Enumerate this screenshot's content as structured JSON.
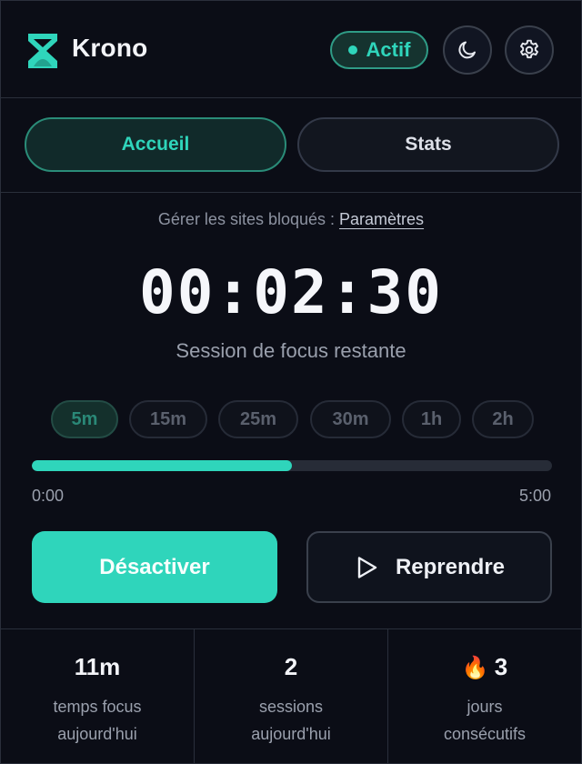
{
  "header": {
    "app_name": "Krono",
    "status_label": "Actif",
    "logo_icon": "hourglass-logo",
    "theme_icon": "moon-icon",
    "settings_icon": "gear-icon"
  },
  "tabs": [
    {
      "label": "Accueil",
      "active": true
    },
    {
      "label": "Stats",
      "active": false
    }
  ],
  "blocked_sites": {
    "prefix": "Gérer les sites bloqués : ",
    "link_label": "Paramètres"
  },
  "timer": {
    "display": "00:02:30",
    "caption": "Session de focus restante"
  },
  "durations": [
    {
      "label": "5m",
      "active": true
    },
    {
      "label": "15m",
      "active": false
    },
    {
      "label": "25m",
      "active": false
    },
    {
      "label": "30m",
      "active": false
    },
    {
      "label": "1h",
      "active": false
    },
    {
      "label": "2h",
      "active": false
    }
  ],
  "progress": {
    "fraction": 0.5,
    "start_label": "0:00",
    "end_label": "5:00"
  },
  "actions": {
    "deactivate_label": "Désactiver",
    "resume_label": "Reprendre",
    "resume_icon": "play-icon"
  },
  "stats": [
    {
      "value": "11m",
      "label_line1": "temps focus",
      "label_line2": "aujourd'hui"
    },
    {
      "value": "2",
      "label_line1": "sessions",
      "label_line2": "aujourd'hui"
    },
    {
      "value": "3",
      "label_line1": "jours",
      "label_line2": "consécutifs",
      "icon": "flame-icon"
    }
  ],
  "colors": {
    "accent": "#2fd5bb",
    "background": "#0b0d16",
    "border": "#2a2f3b"
  }
}
